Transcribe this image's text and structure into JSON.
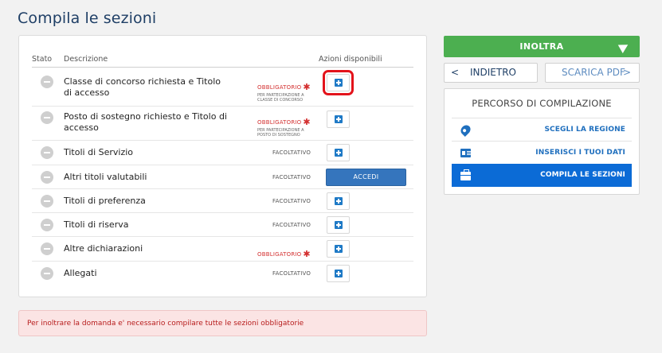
{
  "page": {
    "title": "Compila le sezioni"
  },
  "table": {
    "headers": {
      "stato": "Stato",
      "descrizione": "Descrizione",
      "azioni": "Azioni disponibili"
    },
    "rows": [
      {
        "label": "Classe di concorso richiesta e Titolo di accesso",
        "tag": "OBBLIGATORIO",
        "note": "PER PARTECIPAZIONE A CLASSE DI CONCORSO",
        "action": "plus"
      },
      {
        "label": "Posto di sostegno richiesto e Titolo di accesso",
        "tag": "OBBLIGATORIO",
        "note": "PER PARTECIPAZIONE A POSTO DI SOSTEGNO",
        "action": "plus"
      },
      {
        "label": "Titoli di Servizio",
        "tag": "FACOLTATIVO",
        "action": "plus"
      },
      {
        "label": "Altri titoli valutabili",
        "tag": "FACOLTATIVO",
        "action": "accedi",
        "action_label": "ACCEDI"
      },
      {
        "label": "Titoli di preferenza",
        "tag": "FACOLTATIVO",
        "action": "plus"
      },
      {
        "label": "Titoli di riserva",
        "tag": "FACOLTATIVO",
        "action": "plus"
      },
      {
        "label": "Altre dichiarazioni",
        "tag": "OBBLIGATORIO",
        "action": "plus"
      },
      {
        "label": "Allegati",
        "tag": "FACOLTATIVO",
        "action": "plus"
      }
    ],
    "required_star": "✱"
  },
  "alert": {
    "text": "Per inoltrare la domanda e' necessario compilare tutte le sezioni obbligatorie"
  },
  "sidebar": {
    "inoltra": {
      "label": "INOLTRA",
      "icon": "send-icon"
    },
    "indietro": {
      "chevron": "<",
      "label": "INDIETRO"
    },
    "scarica": {
      "label": "SCARICA PDF",
      "chevron": ">"
    },
    "percorso": {
      "title": "PERCORSO DI COMPILAZIONE",
      "steps": [
        {
          "label": "SCEGLI LA REGIONE",
          "icon": "map-pin-icon",
          "active": false
        },
        {
          "label": "INSERISCI I TUOI DATI",
          "icon": "id-card-icon",
          "active": false
        },
        {
          "label": "COMPILA LE SEZIONI",
          "icon": "briefcase-icon",
          "active": true
        }
      ]
    }
  },
  "colors": {
    "title": "#1f3f66",
    "primary": "#3575bd",
    "success": "#4caf50",
    "danger": "#d32f2f",
    "active_step": "#0b6bd6"
  }
}
